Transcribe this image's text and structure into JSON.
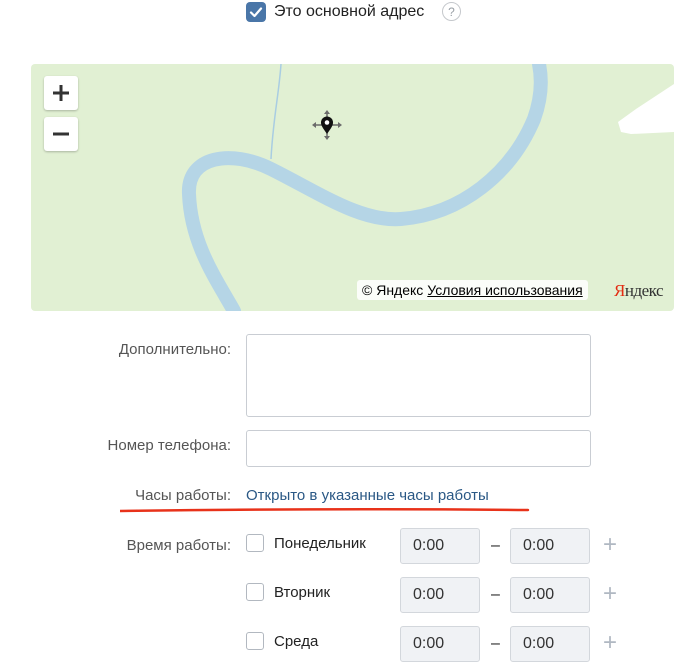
{
  "address": {
    "main_label": "Это основной адрес",
    "help": "?"
  },
  "map": {
    "zoom_in": "+",
    "zoom_out": "−",
    "copyright": "© Яндекс",
    "terms": "Условия использования",
    "logo_first": "Я",
    "logo_rest": "ндекс"
  },
  "form": {
    "extra_label": "Дополнительно:",
    "phone_label": "Номер телефона:",
    "hours_label": "Часы работы:",
    "hours_value": "Открыто в указанные часы работы",
    "schedule_label": "Время работы:",
    "days": [
      {
        "name": "Понедельник",
        "from": "0:00",
        "to": "0:00"
      },
      {
        "name": "Вторник",
        "from": "0:00",
        "to": "0:00"
      },
      {
        "name": "Среда",
        "from": "0:00",
        "to": "0:00"
      }
    ],
    "dash": "–",
    "add": "+"
  },
  "colors": {
    "accent": "#4a76a8",
    "link": "#2a5885",
    "map_land": "#e1f0d3",
    "river": "#b5d5e6",
    "highlight_underline": "#e8321a"
  }
}
